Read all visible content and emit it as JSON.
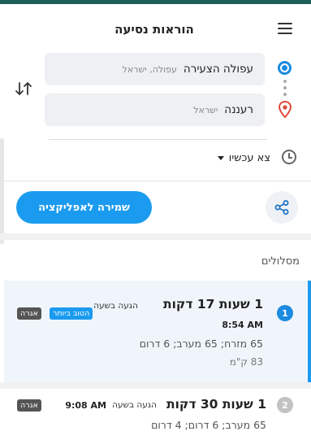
{
  "header": {
    "title": "הוראות נסיעה"
  },
  "route_form": {
    "origin": {
      "name": "עפולה הצעירה",
      "detail": "עפולה, ישראל"
    },
    "destination": {
      "name": "רעננה",
      "detail": "ישראל"
    },
    "departure": "צא עכשיו"
  },
  "actions": {
    "save_label": "שמירה לאפליקציה"
  },
  "routes_section": {
    "label": "מסלולים"
  },
  "routes": [
    {
      "number": "1",
      "duration": "1 שעות 17 דקות",
      "arrive_label": "הגעה בשעה",
      "arrive_time": "8:54 AM",
      "roads": "65 מזרח; 65 מערב; 6 דרום",
      "distance": "83 ק\"מ",
      "badges": [
        "הטוב ביותר",
        "אגרה"
      ]
    },
    {
      "number": "2",
      "duration": "1 שעות 30 דקות",
      "arrive_label": "הגעה בשעה",
      "arrive_time": "9:08 AM",
      "roads": "65 מערב; 6 דרום; 4 דרום",
      "badges": [
        "אגרה"
      ]
    }
  ],
  "colors": {
    "accent": "#1b9bf0",
    "top_bar": "#1d5f59",
    "destination_pin": "#e0493b"
  }
}
